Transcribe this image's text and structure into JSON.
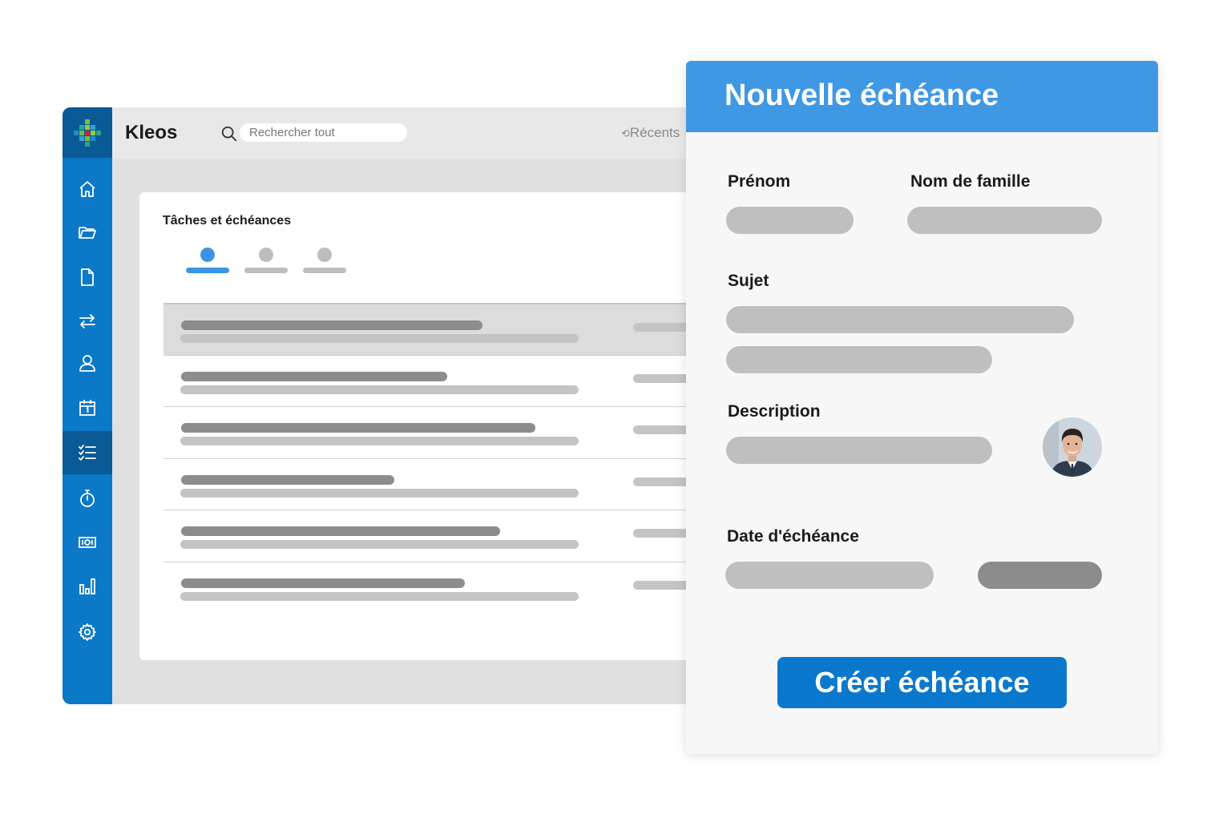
{
  "app": {
    "title": "Kleos",
    "search_placeholder": "Rechercher tout",
    "recents_label": "Récents",
    "recents_icon": "refresh-icon"
  },
  "sidebar": {
    "accent_color": "#0b78c8",
    "active_item": "tasks",
    "items": [
      {
        "id": "home",
        "icon": "home-icon"
      },
      {
        "id": "folders",
        "icon": "folder-icon"
      },
      {
        "id": "documents",
        "icon": "document-icon"
      },
      {
        "id": "transfers",
        "icon": "transfer-arrows-icon"
      },
      {
        "id": "contacts",
        "icon": "person-icon"
      },
      {
        "id": "calendar",
        "icon": "calendar-icon"
      },
      {
        "id": "tasks",
        "icon": "checklist-icon"
      },
      {
        "id": "timer",
        "icon": "stopwatch-icon"
      },
      {
        "id": "billing",
        "icon": "money-icon"
      },
      {
        "id": "reports",
        "icon": "bar-chart-icon"
      },
      {
        "id": "settings",
        "icon": "gear-icon"
      }
    ]
  },
  "card": {
    "title": "Tâches et échéances",
    "tabs_count": 3,
    "active_tab": 0
  },
  "dialog": {
    "title": "Nouvelle échéance",
    "header_color": "#3f98e3",
    "labels": {
      "first_name": "Prénom",
      "last_name": "Nom de famille",
      "subject": "Sujet",
      "description": "Description",
      "due_date": "Date d'échéance"
    },
    "create_button": "Créer échéance",
    "button_color": "#0a78cc"
  }
}
